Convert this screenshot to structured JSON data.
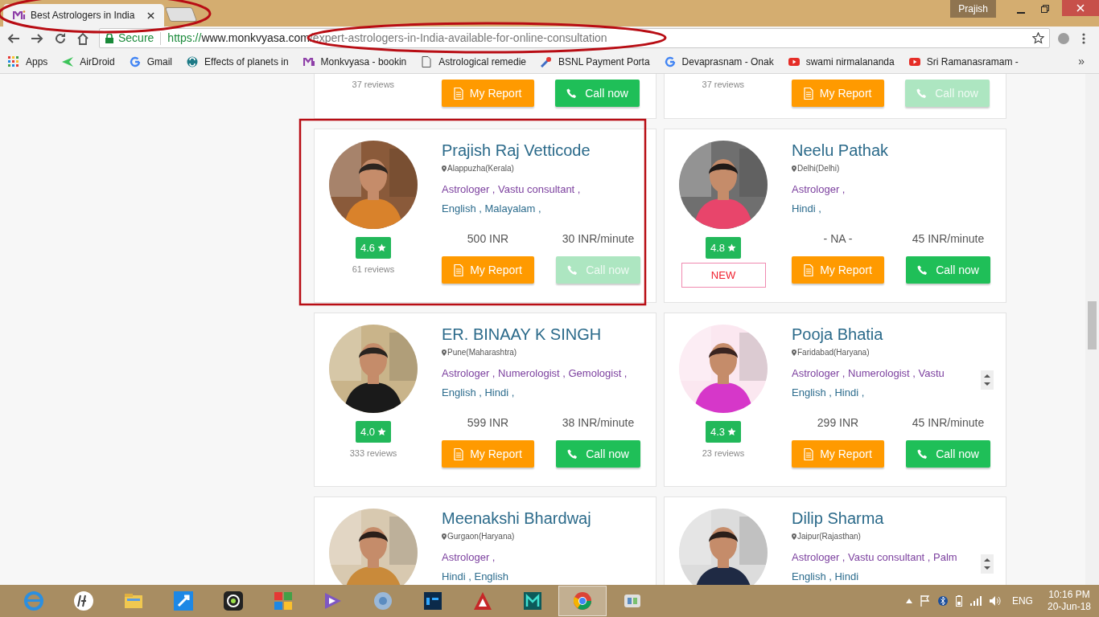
{
  "browser": {
    "tabs": [
      {
        "title": "Best Astrologers in India",
        "selected": true
      }
    ],
    "profile": "Prajish",
    "secure_label": "Secure",
    "url": {
      "scheme": "https://",
      "host": "www.monkvyasa.com",
      "path": "/expert-astrologers-in-India-available-for-online-consultation"
    },
    "bookmarks": [
      {
        "label": "Apps"
      },
      {
        "label": "AirDroid"
      },
      {
        "label": "Gmail"
      },
      {
        "label": "Effects of planets in"
      },
      {
        "label": "Monkvyasa - bookin"
      },
      {
        "label": "Astrological remedie"
      },
      {
        "label": "BSNL Payment Porta"
      },
      {
        "label": "Devaprasnam - Onak"
      },
      {
        "label": "swami nirmalananda"
      },
      {
        "label": "Sri Ramanasramam -"
      }
    ],
    "bookmarks_overflow": "»"
  },
  "clipped_cards": [
    {
      "reviews": "37 reviews",
      "report_button": "My Report",
      "call_button": {
        "label": "Call now",
        "disabled": false
      }
    },
    {
      "reviews": "37 reviews",
      "report_button": "My Report",
      "call_button": {
        "label": "Call now",
        "disabled": true
      }
    }
  ],
  "cards": [
    {
      "name": "Prajish Raj Vetticode",
      "location": "Alappuzha(Kerala)",
      "services": "Astrologer , Vastu consultant ,",
      "languages": "English , Malayalam ,",
      "rating": "4.6",
      "reviews": "61 reviews",
      "report_price": "500 INR",
      "call_price": "30 INR/minute",
      "report_button": "My Report",
      "call_button": {
        "label": "Call now",
        "disabled": true
      },
      "more_arrows": false
    },
    {
      "name": "Neelu Pathak",
      "location": "Delhi(Delhi)",
      "services": "Astrologer ,",
      "languages": "Hindi ,",
      "rating": "4.8",
      "badge": "NEW",
      "report_price": "- NA -",
      "call_price": "45 INR/minute",
      "report_button": "My Report",
      "call_button": {
        "label": "Call now",
        "disabled": false
      },
      "more_arrows": false
    },
    {
      "name": "ER. BINAAY K SINGH",
      "location": "Pune(Maharashtra)",
      "services": "Astrologer , Numerologist , Gemologist ,",
      "languages": "English , Hindi ,",
      "rating": "4.0",
      "reviews": "333 reviews",
      "report_price": "599 INR",
      "call_price": "38 INR/minute",
      "report_button": "My Report",
      "call_button": {
        "label": "Call now",
        "disabled": false
      },
      "more_arrows": false
    },
    {
      "name": "Pooja Bhatia",
      "location": "Faridabad(Haryana)",
      "services": "Astrologer , Numerologist , Vastu",
      "languages": "English , Hindi ,",
      "rating": "4.3",
      "reviews": "23 reviews",
      "report_price": "299 INR",
      "call_price": "45 INR/minute",
      "report_button": "My Report",
      "call_button": {
        "label": "Call now",
        "disabled": false
      },
      "more_arrows": true
    },
    {
      "name": "Meenakshi Bhardwaj",
      "location": "Gurgaon(Haryana)",
      "services": "Astrologer ,",
      "languages": "Hindi , English",
      "more_arrows": false
    },
    {
      "name": "Dilip Sharma",
      "location": "Jaipur(Rajasthan)",
      "services": "Astrologer , Vastu consultant , Palm",
      "languages": "English , Hindi",
      "more_arrows": true
    }
  ],
  "taskbar": {
    "apps": [
      {
        "selected": false
      },
      {
        "selected": false
      },
      {
        "selected": false
      },
      {
        "selected": false
      },
      {
        "selected": false
      },
      {
        "selected": false
      },
      {
        "selected": false
      },
      {
        "selected": false
      },
      {
        "selected": false
      },
      {
        "selected": false
      },
      {
        "selected": false
      },
      {
        "selected": true
      },
      {
        "selected": false
      }
    ],
    "language": "ENG",
    "time": "10:16 PM",
    "date": "20-Jun-18"
  }
}
